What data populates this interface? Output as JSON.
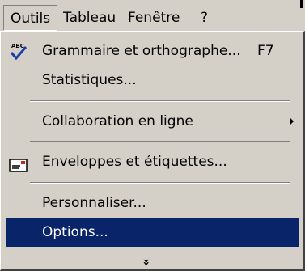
{
  "menubar": {
    "items": [
      {
        "label": "Outils"
      },
      {
        "label": "Tableau"
      },
      {
        "label": "Fenêtre"
      },
      {
        "label": "?"
      }
    ]
  },
  "menu": {
    "items": [
      {
        "label": "Grammaire et orthographe...",
        "shortcut": "F7",
        "icon": "abc-check-icon"
      },
      {
        "label": "Statistiques..."
      },
      {
        "label": "Collaboration en ligne",
        "submenu": true
      },
      {
        "label": "Enveloppes et étiquettes...",
        "icon": "envelope-icon"
      },
      {
        "label": "Personnaliser..."
      },
      {
        "label": "Options...",
        "selected": true
      }
    ],
    "expand_icon": "double-chevron-down-icon",
    "expand_glyph": "»"
  },
  "colors": {
    "menu_bg": "#d4d0c8",
    "highlight": "#0a246a",
    "highlight_text": "#ffffff",
    "checkmark_blue": "#1a3fa8",
    "envelope_red": "#cc2222"
  }
}
